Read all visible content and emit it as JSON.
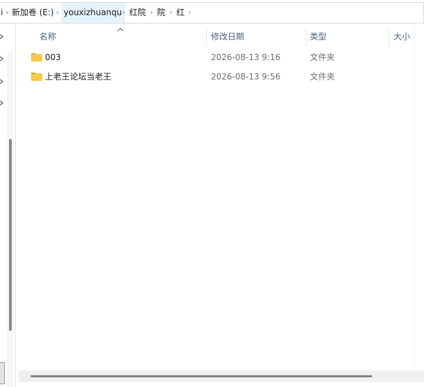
{
  "breadcrumb": {
    "items": [
      {
        "label": "i"
      },
      {
        "label": "新加卷 (E:)"
      },
      {
        "label": "youxizhuanqu"
      },
      {
        "label": "红院"
      },
      {
        "label": "院"
      },
      {
        "label": "红"
      }
    ],
    "separator": "›"
  },
  "columns": {
    "name": "名称",
    "date": "修改日期",
    "type": "类型",
    "size": "大小"
  },
  "files": [
    {
      "name": "003",
      "modified": "2026-08-13 9:16",
      "type": "文件夹",
      "icon": "folder-icon"
    },
    {
      "name": "上老王论坛当老王",
      "modified": "2026-08-13 9:56",
      "type": "文件夹",
      "icon": "folder-icon"
    }
  ],
  "colors": {
    "folder": "#f8c742",
    "folder_dark": "#e0a526",
    "header_text": "#4c607a",
    "selected_crumb": "#e5f3ff"
  }
}
